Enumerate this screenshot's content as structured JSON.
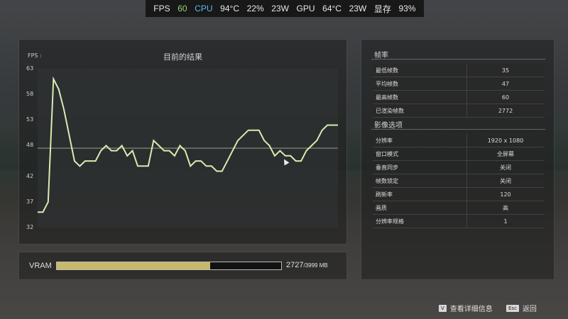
{
  "topbar": {
    "fps_label": "FPS",
    "fps_value": "60",
    "cpu_label": "CPU",
    "cpu_temp": "94°C",
    "cpu_usage": "22%",
    "cpu_power": "23W",
    "gpu_label": "GPU",
    "gpu_temp": "64°C",
    "gpu_power": "23W",
    "vram_label": "显存",
    "vram_usage": "93%"
  },
  "chart": {
    "title": "目前的结果",
    "y_label": "FPS :"
  },
  "chart_data": {
    "type": "line",
    "title": "目前的结果",
    "ylabel": "FPS :",
    "xlabel": "",
    "ylim": [
      32,
      63
    ],
    "yticks": [
      63,
      58,
      53,
      48,
      42,
      37,
      32
    ],
    "grid": false,
    "reference_line": 47.5,
    "series": [
      {
        "values": [
          35,
          35,
          37,
          61,
          59,
          55,
          50,
          45,
          44,
          45,
          45,
          45,
          47,
          48,
          47,
          47,
          48,
          46,
          47,
          44,
          44,
          44,
          49,
          48,
          47,
          47,
          46,
          48,
          47,
          44,
          45,
          45,
          44,
          44,
          43,
          43,
          45,
          47,
          49,
          50,
          51,
          51,
          51,
          49,
          48,
          46,
          47,
          46,
          46,
          45,
          45,
          47,
          48,
          49,
          51,
          52,
          52,
          52
        ]
      }
    ],
    "color": "#d8ecb0"
  },
  "vram": {
    "label": "VRAM",
    "used": "2727",
    "total": "/3999 MB",
    "fraction": 0.682
  },
  "framerate": {
    "title": "帧率",
    "rows": [
      {
        "k": "最低帧数",
        "v": "35"
      },
      {
        "k": "平均帧数",
        "v": "47"
      },
      {
        "k": "最高帧数",
        "v": "60"
      },
      {
        "k": "已渲染帧数",
        "v": "2772"
      }
    ]
  },
  "image_options": {
    "title": "影像选项",
    "rows": [
      {
        "k": "分辨率",
        "v": "1920 x 1080"
      },
      {
        "k": "窗口模式",
        "v": "全屏幕"
      },
      {
        "k": "垂直同步",
        "v": "关闭"
      },
      {
        "k": "帧数锁定",
        "v": "关闭"
      },
      {
        "k": "刷新率",
        "v": "120"
      },
      {
        "k": "画质",
        "v": "高"
      },
      {
        "k": "分辨率规格",
        "v": "1"
      }
    ]
  },
  "footer": {
    "details_key": "V",
    "details_label": "查看详细信息",
    "back_key": "Esc",
    "back_label": "返回"
  }
}
